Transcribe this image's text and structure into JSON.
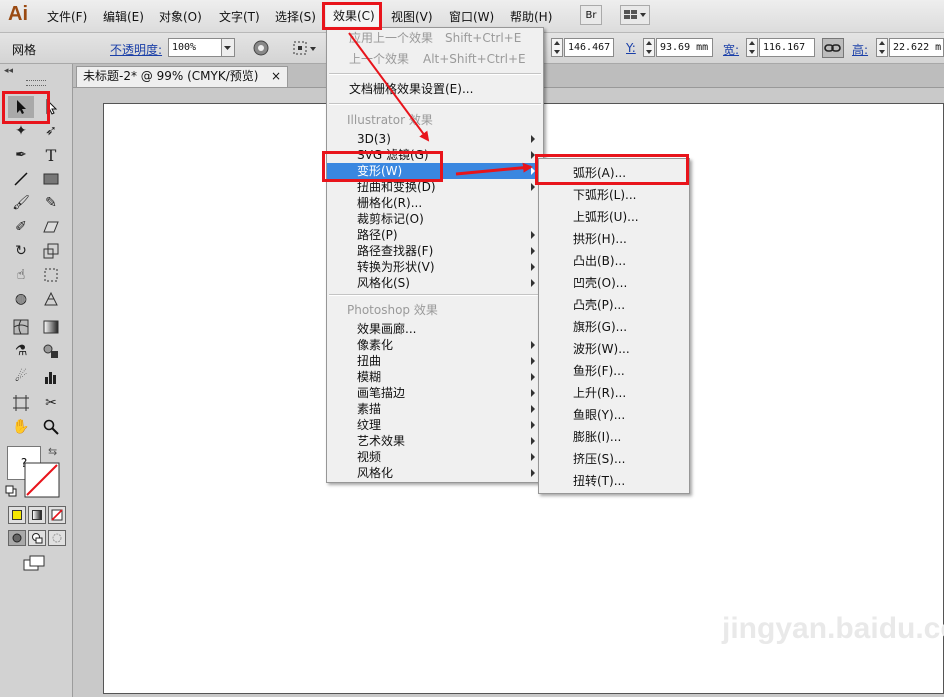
{
  "app": {
    "logo": "Ai"
  },
  "menubar": {
    "items": [
      "文件(F)",
      "编辑(E)",
      "对象(O)",
      "文字(T)",
      "选择(S)",
      "效果(C)",
      "视图(V)",
      "窗口(W)",
      "帮助(H)"
    ],
    "bridge_button": "Br"
  },
  "controlbar": {
    "object_type": "网格",
    "opacity_label": "不透明度:",
    "opacity_value": "100%",
    "x_value": "146.467",
    "y_label": "Y:",
    "y_value": "93.69 mm",
    "w_label": "宽:",
    "w_value": "116.167",
    "h_label": "高:",
    "h_value": "22.622 m"
  },
  "document": {
    "tab_title": "未标题-2* @ 99% (CMYK/预览)",
    "close_glyph": "×"
  },
  "toolbox": {
    "collapse_glyph": "◂◂",
    "default_colors_glyph": "?"
  },
  "effect_menu": {
    "apply_last": "应用上一个效果",
    "apply_last_shortcut": "Shift+Ctrl+E",
    "last_effect": "上一个效果",
    "last_effect_shortcut": "Alt+Shift+Ctrl+E",
    "doc_raster_settings": "文档栅格效果设置(E)...",
    "illustrator_group": "Illustrator 效果",
    "illustrator_items": [
      "3D(3)",
      "SVG 滤镜(G)",
      "变形(W)",
      "扭曲和变换(D)",
      "栅格化(R)...",
      "裁剪标记(O)",
      "路径(P)",
      "路径查找器(F)",
      "转换为形状(V)",
      "风格化(S)"
    ],
    "photoshop_group": "Photoshop 效果",
    "photoshop_items": [
      "效果画廊...",
      "像素化",
      "扭曲",
      "模糊",
      "画笔描边",
      "素描",
      "纹理",
      "艺术效果",
      "视频",
      "风格化"
    ]
  },
  "warp_submenu": {
    "items": [
      "弧形(A)...",
      "下弧形(L)...",
      "上弧形(U)...",
      "拱形(H)...",
      "凸出(B)...",
      "凹壳(O)...",
      "凸壳(P)...",
      "旗形(G)...",
      "波形(W)...",
      "鱼形(F)...",
      "上升(R)...",
      "鱼眼(Y)...",
      "膨胀(I)...",
      "挤压(S)...",
      "扭转(T)..."
    ]
  },
  "watermark": "jingyan.baidu.com",
  "colors": {
    "highlight": "#3a87e0",
    "annotation_red": "#e8141b",
    "logo": "#9a4a12"
  }
}
